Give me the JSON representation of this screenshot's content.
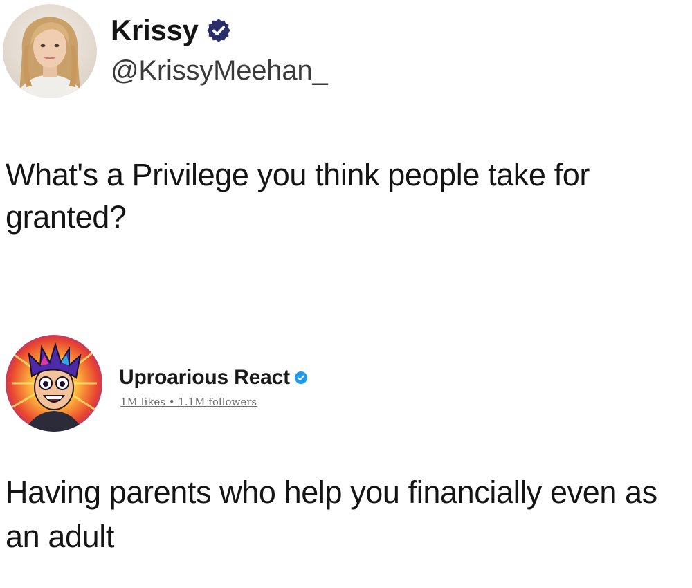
{
  "tweet": {
    "author_name": "Krissy",
    "author_handle": "@KrissyMeehan_",
    "verified": true,
    "text": "What's a Privilege you think people take for granted?"
  },
  "reply": {
    "page_name": "Uproarious React",
    "verified": true,
    "stats": "1M likes • 1.1M followers",
    "text": "Having parents who help you financially even as an adult"
  },
  "colors": {
    "verified_blue": "#1d9bf0",
    "badge_dark": "#2a2f6b",
    "text": "#141414",
    "handle": "#3a3a3a",
    "stats": "#6b6b6b"
  },
  "icons": {
    "tweet_verified": "verified-badge-icon",
    "reply_verified": "verified-badge-icon"
  }
}
